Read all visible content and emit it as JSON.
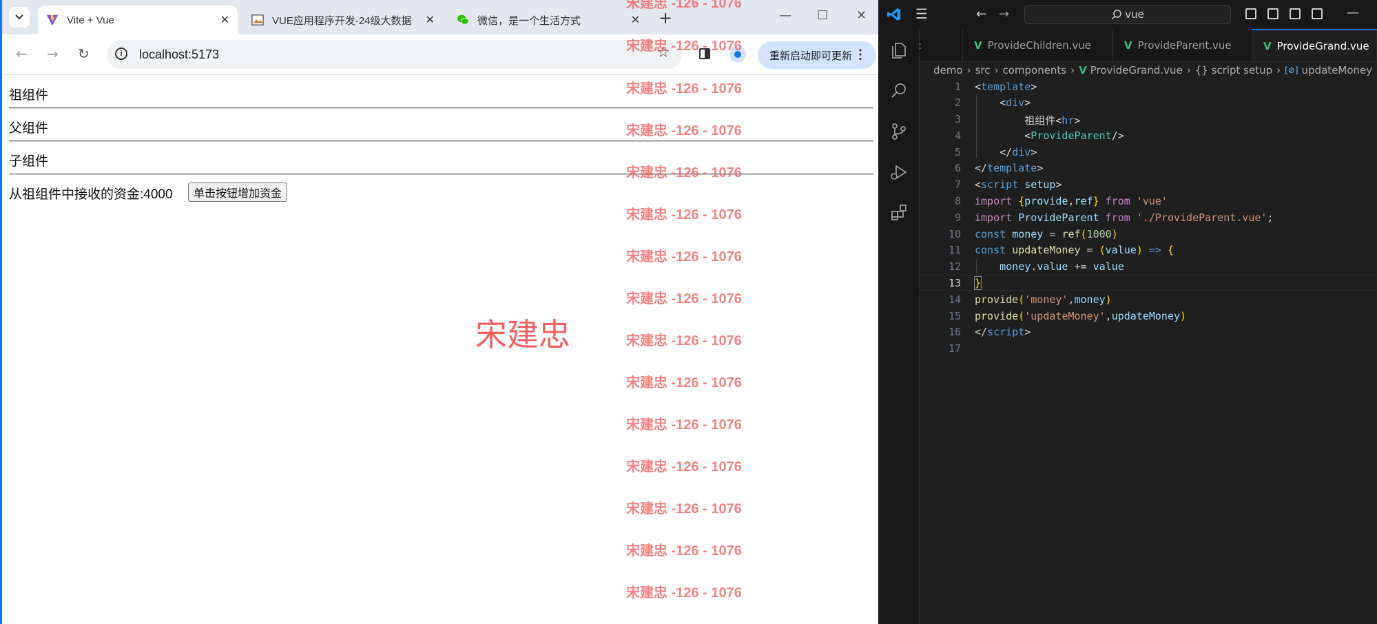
{
  "browser": {
    "tabs": [
      {
        "title": "Vite + Vue",
        "active": true,
        "favicon": "vite-icon"
      },
      {
        "title": "VUE应用程序开发-24级大数据",
        "active": false,
        "favicon": "image-icon"
      },
      {
        "title": "微信，是一个生活方式",
        "active": false,
        "favicon": "wechat-icon"
      }
    ],
    "url": "localhost:5173",
    "update_label": "重新启动即可更新"
  },
  "page": {
    "grand_label": "祖组件",
    "parent_label": "父组件",
    "child_label": "子组件",
    "money_text": "从祖组件中接收的资金:4000",
    "add_button_label": "单击按钮增加资金"
  },
  "watermark": {
    "text": "宋建忠 -126 - 1076",
    "center_text": "宋建忠"
  },
  "vscode": {
    "search_text": "vue",
    "tabs": [
      {
        "title": "ProvideChildren.vue",
        "active": false
      },
      {
        "title": "ProvideParent.vue",
        "active": false
      },
      {
        "title": "ProvideGrand.vue",
        "active": true
      }
    ],
    "breadcrumb": [
      "demo",
      "src",
      "components",
      "ProvideGrand.vue",
      "{} script setup",
      "updateMoney"
    ],
    "current_line": 13
  },
  "colors": {
    "accent": "#1a73e8",
    "vue_green": "#41b883",
    "watermark": "#f05a5a",
    "editor_bg": "#1f1f1f"
  }
}
